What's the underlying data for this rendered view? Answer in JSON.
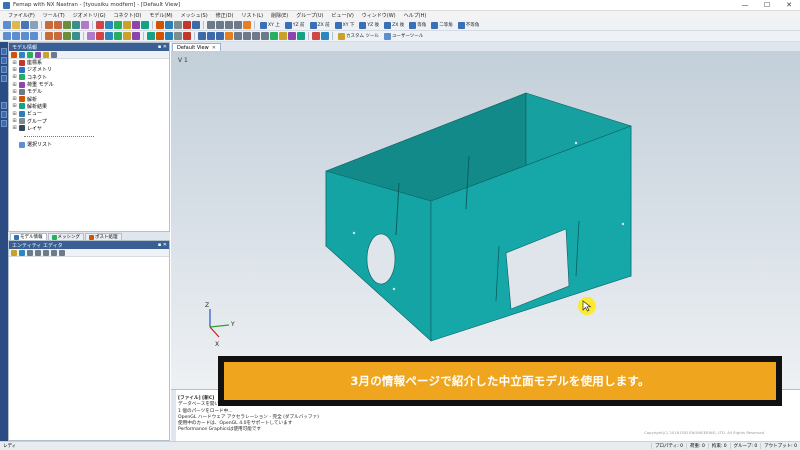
{
  "window": {
    "title": "Femap with NX Nastran - [tyousiku modfem] - [Default View]",
    "controls": [
      "—",
      "☐",
      "✕"
    ]
  },
  "menu": [
    "ファイル(F)",
    "ツール(T)",
    "ジオメトリ(G)",
    "コネクト(O)",
    "モデル(M)",
    "メッシュ(S)",
    "修正(D)",
    "リスト(L)",
    "削除(E)",
    "グループ(U)",
    "ビュー(V)",
    "ウィンドウ(W)",
    "ヘルプ(H)"
  ],
  "toolbar": {
    "view_buttons": [
      "XY 上",
      "YZ 前",
      "ZX 前",
      "XY 下",
      "YZ 後",
      "ZX 後",
      "等角",
      "二等角",
      "不等角"
    ],
    "custom_tools": "カスタム ツール",
    "user_tools": "ユーザーツール"
  },
  "doc_tab": {
    "label": "Default View",
    "close": "✕"
  },
  "model_panel": {
    "title": "モデル情報",
    "pin": "▪ ✕",
    "tree": [
      {
        "label": "座標系",
        "expander": "⊞",
        "icon_color": "#c0392b"
      },
      {
        "label": "ジオメトリ",
        "expander": "⊞",
        "icon_color": "#2f6fc1"
      },
      {
        "label": "コネクト",
        "expander": "⊞",
        "icon_color": "#27ae60"
      },
      {
        "label": "荷重 モデル",
        "expander": "⊞",
        "icon_color": "#8e44ad"
      },
      {
        "label": "モデル",
        "expander": "⊞",
        "icon_color": "#6c7a89"
      },
      {
        "label": "解析",
        "expander": "⊞",
        "icon_color": "#d35400"
      },
      {
        "label": "解析結果",
        "expander": "⊞",
        "icon_color": "#16a085"
      },
      {
        "label": "ビュー",
        "expander": "⊞",
        "icon_color": "#2980b9"
      },
      {
        "label": "グループ",
        "expander": "⊞",
        "icon_color": "#7f8c8d"
      },
      {
        "label": "レイヤ",
        "expander": "⊞",
        "icon_color": "#34495e"
      }
    ],
    "selection_list": "選択リスト"
  },
  "bottom_tabs": [
    "モデル情報",
    "メッシング",
    "ポスト処理"
  ],
  "entity_panel": {
    "title": "エンティティ エディタ",
    "pin": "▪ ✕"
  },
  "viewport": {
    "label": "V 1",
    "model_color": "#0f8585",
    "triad": {
      "x": "X",
      "y": "Y",
      "z": "Z"
    }
  },
  "output": {
    "lines": [
      "[ファイル] [新C]",
      "データベースを開いています",
      "1 個のパーツをロード中...",
      "OpenGL ハードウェア アクセラレーション - 完全 (ダブルバッファ)",
      "使用中のカードは、OpenGL 4.0をサポートしています",
      "Performance Graphicsは使用可能です"
    ],
    "copyright": "Copyright(C) 2018 ISID ENGINEERING, LTD. All Rights Reserved"
  },
  "status": {
    "ready": "レディ",
    "items": [
      "プロパティ: 0",
      "荷重: 0",
      "拘束: 0",
      "グループ: 0",
      "アウトプット: 0"
    ]
  },
  "banner": {
    "text": "3月の情報ページで紹介した中立面モデルを使用します。"
  }
}
